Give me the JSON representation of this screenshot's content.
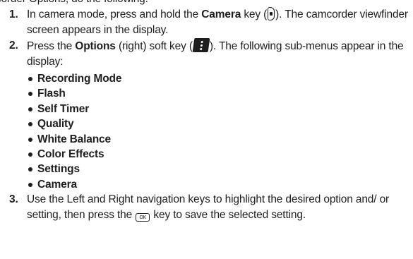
{
  "header_fragment": "corder Options, do the following:",
  "steps": [
    {
      "number": "1.",
      "t1": "In camera mode, press and hold the ",
      "b1": "Camera",
      "t2": " key (",
      "t3": "). The camcorder viewfinder screen appears in the display."
    },
    {
      "number": "2.",
      "t1": "Press the ",
      "b1": "Options",
      "t2": " (right) soft key (",
      "t3": "). The following sub-menus appear in the display:",
      "submenu": [
        "Recording Mode",
        "Flash",
        "Self Timer",
        "Quality",
        "White Balance",
        "Color Effects",
        "Settings",
        "Camera"
      ]
    },
    {
      "number": "3.",
      "t1": "Use the Left and Right navigation keys to highlight the desired option and/ or setting, then press the ",
      "t2": " key to save the selected setting."
    }
  ],
  "icons": {
    "camera_key": "camera-key-icon",
    "options_key": "options-soft-key-icon",
    "ok_key": "ok-key-icon",
    "ok_key_label": "OK"
  }
}
